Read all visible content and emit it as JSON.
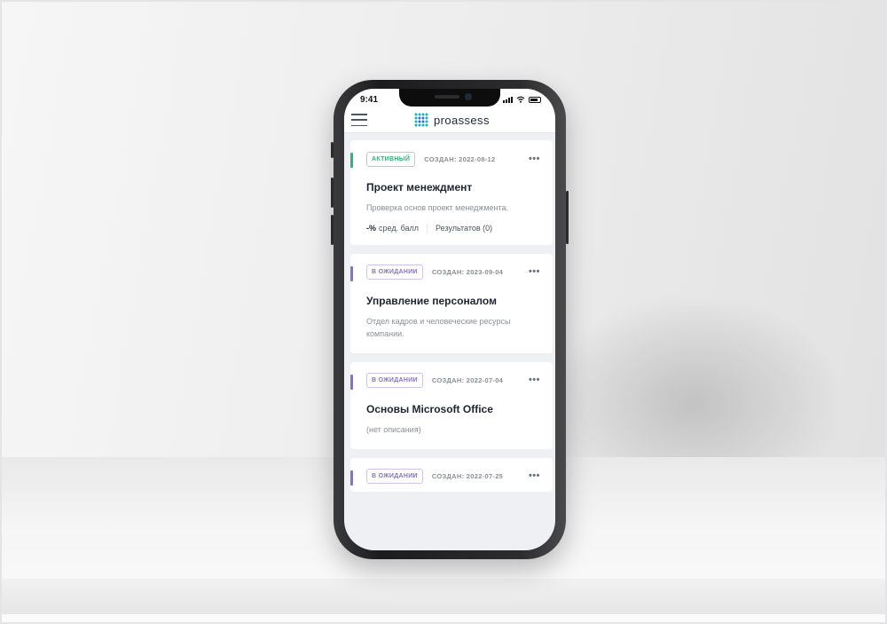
{
  "status": {
    "time": "9:41"
  },
  "header": {
    "logo_text": "proassess"
  },
  "colors": {
    "active": "#2fb675",
    "pending": "#8b6fd0",
    "brand": "#19b3b1"
  },
  "assessments": [
    {
      "status_label": "АКТИВНЫЙ",
      "status": "active",
      "created": "СОЗДАН: 2022-08-12",
      "title": "Проект менеждмент",
      "description": "Проверка основ проект менеджмента.",
      "avg_value": "-%",
      "avg_label": "сред. балл",
      "results_label": "Результатов (0)"
    },
    {
      "status_label": "В ОЖИДАНИИ",
      "status": "pending",
      "created": "СОЗДАН: 2023-09-04",
      "title": "Управление персоналом",
      "description": "Отдел кадров и человеческие ресурсы компании."
    },
    {
      "status_label": "В ОЖИДАНИИ",
      "status": "pending",
      "created": "СОЗДАН: 2022-07-04",
      "title": "Основы Microsoft Office",
      "description": "(нет описания)"
    },
    {
      "status_label": "В ОЖИДАНИИ",
      "status": "pending",
      "created": "СОЗДАН: 2022-07-25"
    }
  ]
}
